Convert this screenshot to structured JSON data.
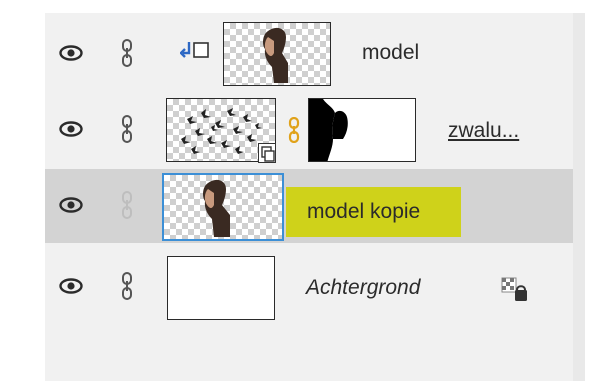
{
  "panel": {
    "layers": [
      {
        "name": "model",
        "style": "normal",
        "clipped": true,
        "visible": true,
        "selected": false
      },
      {
        "name": "zwalu...",
        "style": "underline",
        "smart_object": true,
        "has_mask": true,
        "visible": true,
        "selected": false
      },
      {
        "name": "model kopie",
        "style": "highlight",
        "visible": true,
        "selected": true
      },
      {
        "name": "Achtergrond",
        "style": "italic",
        "locked": true,
        "visible": true,
        "selected": false
      }
    ]
  },
  "colors": {
    "selection": "#d3d3d3",
    "highlight": "#cfd21a",
    "active_border": "#3c8fd6",
    "link_gold": "#e0a21a"
  },
  "icons": {
    "visibility": "eye-icon",
    "link": "chain-link-icon",
    "clip": "clipping-arrow-icon",
    "lock": "lock-icon",
    "smart_object": "smart-object-badge-icon"
  }
}
